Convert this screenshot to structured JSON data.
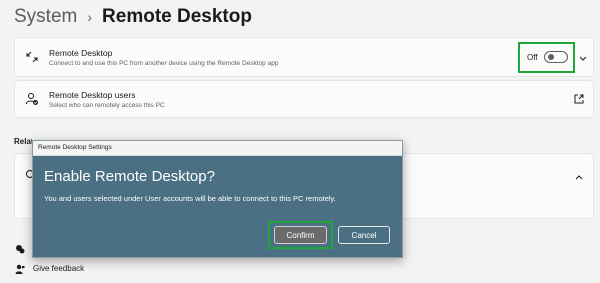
{
  "breadcrumb": {
    "parent": "System",
    "separator": "›",
    "current": "Remote Desktop"
  },
  "remote_desktop": {
    "title": "Remote Desktop",
    "description": "Connect to and use this PC from another device using the Remote Desktop app",
    "toggle_label": "Off",
    "toggle_on": false,
    "icon": "remote-desktop-icon"
  },
  "users": {
    "title": "Remote Desktop users",
    "description": "Select who can remotely access this PC",
    "icon": "users-icon"
  },
  "related": {
    "heading": "Related"
  },
  "footer": {
    "feedback_label": "Give feedback"
  },
  "dialog": {
    "window_title": "Remote Desktop Settings",
    "heading": "Enable Remote Desktop?",
    "message": "You and users selected under User accounts will be able to connect to this PC remotely.",
    "confirm_label": "Confirm",
    "cancel_label": "Cancel"
  },
  "colors": {
    "highlight": "#1fa83a",
    "dialog_bg": "#4b7083",
    "page_bg": "#f3f3f3"
  }
}
